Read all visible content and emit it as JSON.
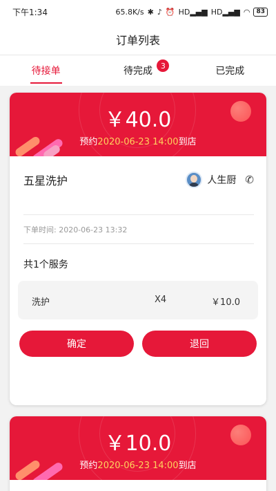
{
  "status_bar": {
    "time": "下午1:34",
    "speed": "65.8K/s",
    "signal_1": "HD",
    "signal_2": "HD",
    "battery": "83"
  },
  "nav": {
    "title": "订单列表"
  },
  "tabs": [
    {
      "label": "待接单",
      "active": true
    },
    {
      "label": "待完成",
      "badge": "3"
    },
    {
      "label": "已完成"
    }
  ],
  "orders": [
    {
      "amount": "￥40.0",
      "appoint_prefix": "预约",
      "appoint_time": "2020-06-23 14:00",
      "appoint_suffix": "到店",
      "service_name": "五星洗护",
      "user_name": "人生厨",
      "order_time": "下单时间: 2020-06-23 13:32",
      "service_count": "共1个服务",
      "items": [
        {
          "name": "洗护",
          "qty": "X4",
          "price": "￥10.0"
        }
      ],
      "confirm_label": "确定",
      "return_label": "退回"
    },
    {
      "amount": "￥10.0",
      "appoint_prefix": "预约",
      "appoint_time": "2020-06-23 14:00",
      "appoint_suffix": "到店"
    }
  ],
  "colors": {
    "accent": "#e61839",
    "highlight": "#ffd15c"
  }
}
